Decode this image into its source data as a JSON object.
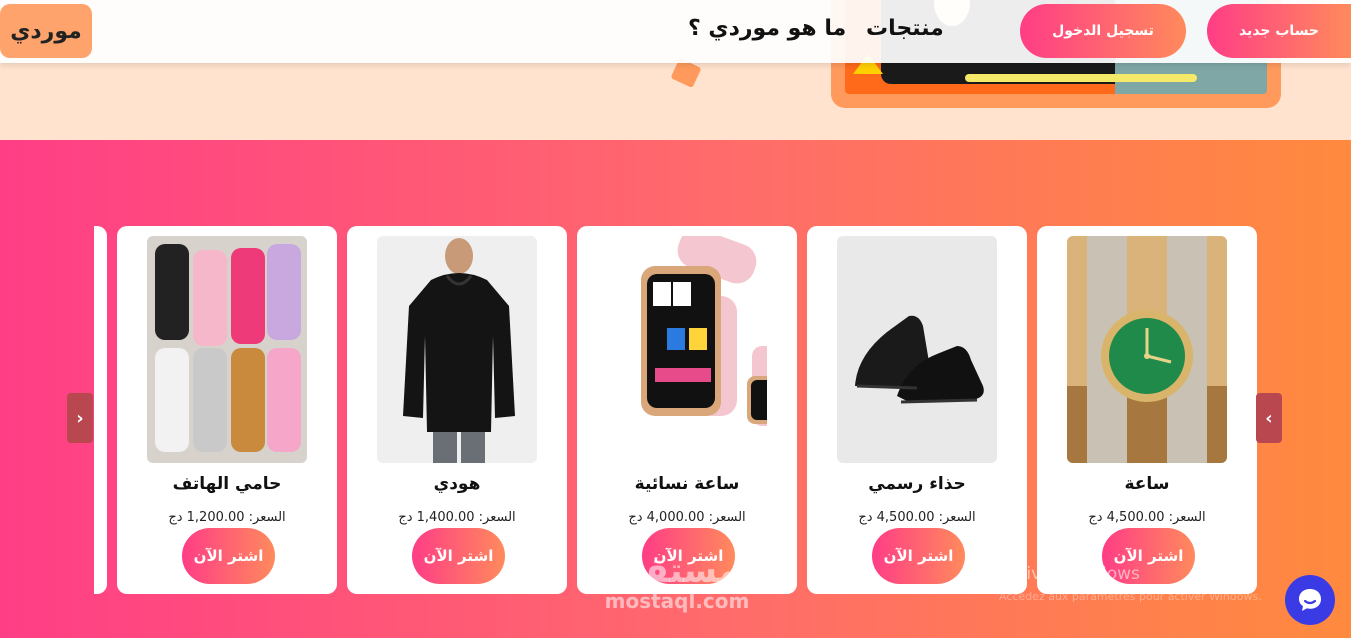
{
  "navbar": {
    "logo": "موردي",
    "links": {
      "about": "ما هو موردي ؟",
      "products": "منتجات"
    },
    "buttons": {
      "login": "تسجيل الدخول",
      "signup": "حساب جديد"
    }
  },
  "carousel": {
    "prev_icon": "‹",
    "next_icon": "›",
    "products": [
      {
        "name": "ساعة",
        "price": "السعر: 4,500.00 دج",
        "buy": "اشتر الآن",
        "image": "gold-watch"
      },
      {
        "name": "حذاء رسمي",
        "price": "السعر: 4,500.00 دج",
        "buy": "اشتر الآن",
        "image": "black-shoes"
      },
      {
        "name": "ساعة نسائية",
        "price": "السعر: 4,000.00 دج",
        "buy": "اشتر الآن",
        "image": "pink-smartwatch"
      },
      {
        "name": "هودي",
        "price": "السعر: 1,400.00 دج",
        "buy": "اشتر الآن",
        "image": "black-hoodie"
      },
      {
        "name": "حامي الهاتف",
        "price": "السعر: 1,200.00 دج",
        "buy": "اشتر الآن",
        "image": "phone-cases"
      }
    ]
  },
  "watermark": {
    "arabic": "مستقل",
    "latin": "mostaql.com"
  },
  "windows": {
    "title": "Activer Windows",
    "subtitle": "Accédez aux paramètres pour activer Windows."
  },
  "colors": {
    "accent_start": "#ff3d86",
    "accent_end": "#ff8a5c",
    "logo_bg": "#ffa36d",
    "chat": "#3b3be6"
  }
}
